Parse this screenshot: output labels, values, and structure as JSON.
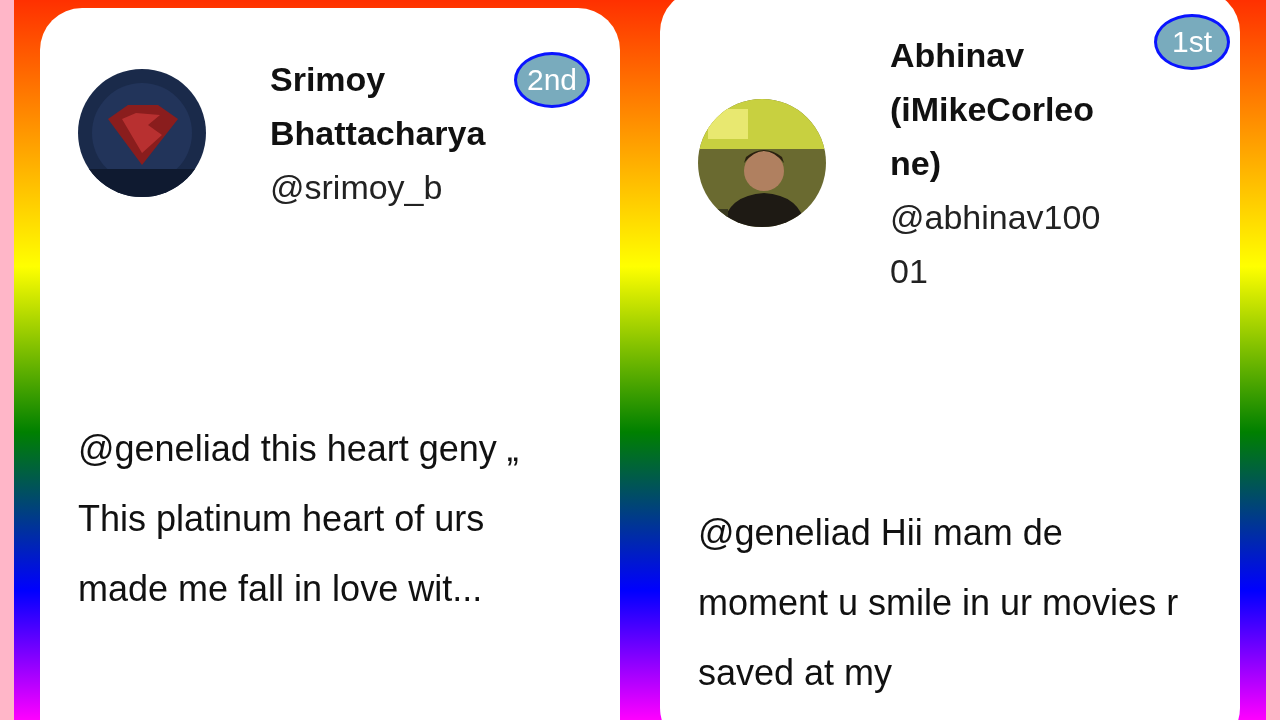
{
  "cards": [
    {
      "name": "Srimoy Bhattacharya",
      "handle": "@srimoy_b",
      "rank": "2nd",
      "text": "@geneliad this heart geny „ This platinum heart of urs made me fall in love wit..."
    },
    {
      "name": "Abhinav (iMikeCorleone)",
      "handle": "@abhinav10001",
      "rank": "1st",
      "text": "@geneliad Hii mam de moment u smile in ur movies r saved at my"
    }
  ]
}
